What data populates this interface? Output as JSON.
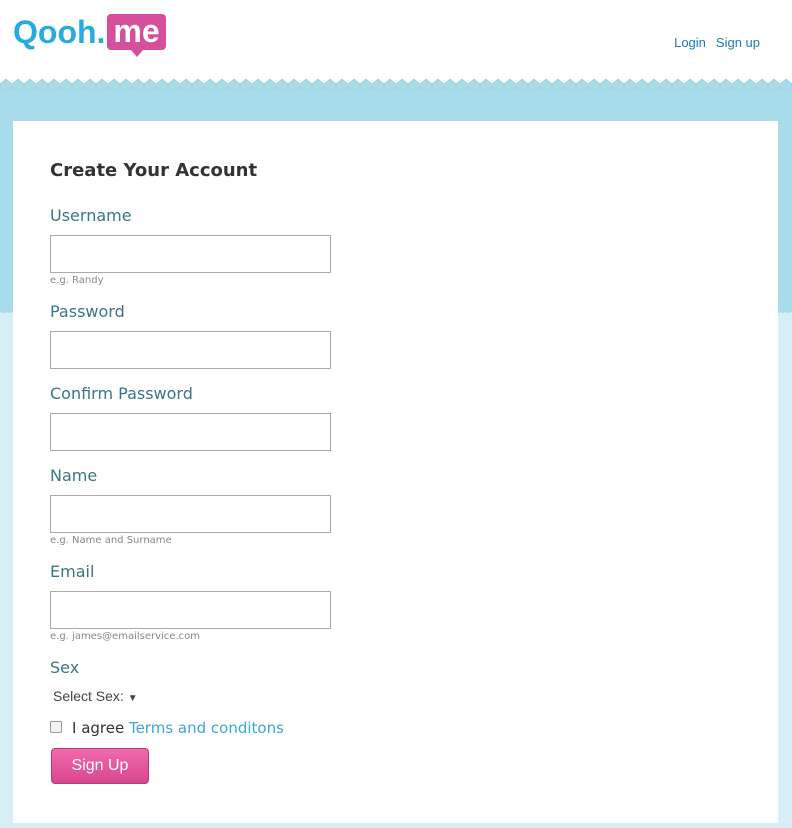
{
  "header": {
    "logo_main": "Qooh.",
    "logo_badge": "me",
    "nav": [
      "Login",
      "Sign up"
    ]
  },
  "form": {
    "title": "Create Your Account",
    "username": {
      "label": "Username",
      "value": "",
      "hint": "e.g. Randy"
    },
    "password": {
      "label": "Password",
      "value": ""
    },
    "confirm": {
      "label": "Confirm Password",
      "value": ""
    },
    "name": {
      "label": "Name",
      "value": "",
      "hint": "e.g. Name and Surname"
    },
    "email": {
      "label": "Email",
      "value": "",
      "hint": "e.g. james@emailservice.com"
    },
    "sex": {
      "label": "Sex",
      "selected": "Select Sex:"
    },
    "agree": {
      "text": "I agree ",
      "link": "Terms and conditons",
      "checked": false
    },
    "submit": "Sign Up"
  },
  "colors": {
    "brand_blue": "#29abe2",
    "brand_pink": "#d64f9c",
    "band": "#a9dcea"
  }
}
